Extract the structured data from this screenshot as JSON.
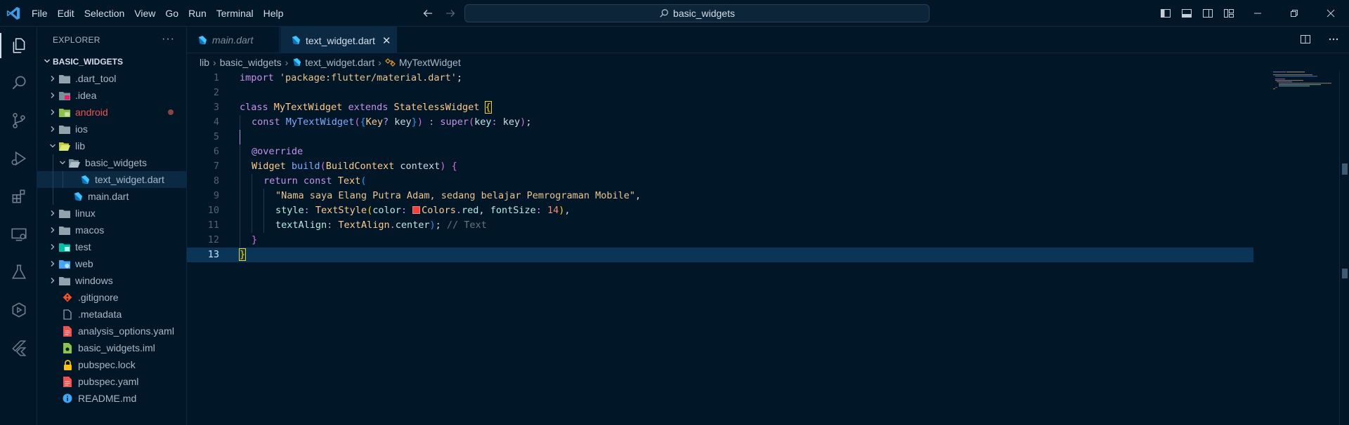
{
  "menu": {
    "items": [
      "File",
      "Edit",
      "Selection",
      "View",
      "Go",
      "Run",
      "Terminal",
      "Help"
    ]
  },
  "command_center": {
    "text": "basic_widgets"
  },
  "sidebar": {
    "title": "EXPLORER",
    "more": "···",
    "project": "BASIC_WIDGETS",
    "tree": [
      {
        "name": ".dart_tool",
        "type": "folder"
      },
      {
        "name": ".idea",
        "type": "folder"
      },
      {
        "name": "android",
        "type": "folder"
      },
      {
        "name": "ios",
        "type": "folder"
      },
      {
        "name": "lib",
        "type": "folder"
      },
      {
        "name": "basic_widgets",
        "type": "folder"
      },
      {
        "name": "text_widget.dart",
        "type": "file"
      },
      {
        "name": "main.dart",
        "type": "file"
      },
      {
        "name": "linux",
        "type": "folder"
      },
      {
        "name": "macos",
        "type": "folder"
      },
      {
        "name": "test",
        "type": "folder"
      },
      {
        "name": "web",
        "type": "folder"
      },
      {
        "name": "windows",
        "type": "folder"
      },
      {
        "name": ".gitignore",
        "type": "file"
      },
      {
        "name": ".metadata",
        "type": "file"
      },
      {
        "name": "analysis_options.yaml",
        "type": "file"
      },
      {
        "name": "basic_widgets.iml",
        "type": "file"
      },
      {
        "name": "pubspec.lock",
        "type": "file"
      },
      {
        "name": "pubspec.yaml",
        "type": "file"
      },
      {
        "name": "README.md",
        "type": "file"
      }
    ]
  },
  "tabs": [
    {
      "label": "main.dart",
      "active": false
    },
    {
      "label": "text_widget.dart",
      "active": true,
      "close": "✕"
    }
  ],
  "breadcrumb": [
    "lib",
    "basic_widgets",
    "text_widget.dart",
    "MyTextWidget"
  ],
  "code": {
    "line_numbers": [
      "1",
      "2",
      "3",
      "4",
      "5",
      "6",
      "7",
      "8",
      "9",
      "10",
      "11",
      "12",
      "13"
    ],
    "l1": {
      "kw": "import",
      "str": "'package:flutter/material.dart'",
      "end": ";"
    },
    "l3": {
      "kw1": "class",
      "cls": "MyTextWidget",
      "kw2": "extends",
      "cls2": "StatelessWidget",
      "br": "{"
    },
    "l4": {
      "kw": "const",
      "fn": "MyTextWidget",
      "p1": "(",
      "b1": "{",
      "t": "Key",
      "q": "?",
      "v": "key",
      "b2": "}",
      "p2": ")",
      "colon": " : ",
      "sup": "super",
      "p3": "(",
      "arg": "key",
      "argc": ": ",
      "v2": "key",
      "p4": ")",
      "end": ";"
    },
    "l6": {
      "ann": "@override"
    },
    "l7": {
      "cls": "Widget",
      "fn": "build",
      "p1": "(",
      "t": "BuildContext",
      "v": "context",
      "p2": ")",
      "br": "{"
    },
    "l8": {
      "kw1": "return",
      "kw2": "const",
      "cls": "Text",
      "p": "("
    },
    "l9": {
      "str": "\"Nama saya Elang Putra Adam, sedang belajar Pemrograman Mobile\"",
      "end": ","
    },
    "l10": {
      "prop": "style",
      "c": ": ",
      "cls": "TextStyle",
      "p1": "(",
      "prop2": "color",
      "c2": ": ",
      "cls2": "Colors",
      "dot": ".",
      "prop3": "red",
      "comma": ", ",
      "prop4": "fontSize",
      "c3": ": ",
      "num": "14",
      "p2": ")",
      "end": ","
    },
    "l11": {
      "prop": "textAlign",
      "c": ": ",
      "cls": "TextAlign",
      "dot": ".",
      "prop2": "center",
      "p": ")",
      "end": ";",
      "cmt": "// Text"
    },
    "l12": {
      "br": "}"
    },
    "l13": {
      "br": "}"
    }
  },
  "colors": {
    "background": "#011627",
    "accent": "#0b2942",
    "current_line": "#0b3557",
    "swatch_red": "#f44336"
  },
  "icons": {
    "activity": [
      "explorer-icon",
      "search-icon",
      "source-control-icon",
      "run-debug-icon",
      "extensions-icon",
      "remote-explorer-icon",
      "testing-icon",
      "docker-icon",
      "flutter-icon"
    ]
  }
}
